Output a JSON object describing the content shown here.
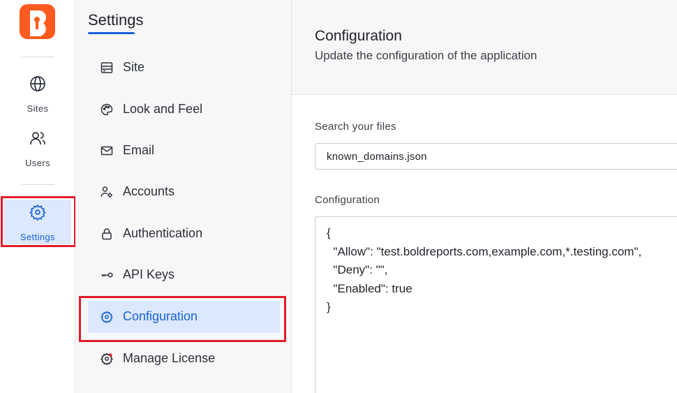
{
  "rail": {
    "logo_letter": "B",
    "items": [
      {
        "label": "Sites",
        "icon": "globe-icon"
      },
      {
        "label": "Users",
        "icon": "users-icon"
      },
      {
        "label": "Settings",
        "icon": "gear-icon",
        "active": true
      }
    ]
  },
  "menu": {
    "title": "Settings",
    "items": [
      {
        "label": "Site",
        "icon": "site-icon"
      },
      {
        "label": "Look and Feel",
        "icon": "palette-icon"
      },
      {
        "label": "Email",
        "icon": "mail-icon"
      },
      {
        "label": "Accounts",
        "icon": "account-settings-icon"
      },
      {
        "label": "Authentication",
        "icon": "lock-icon"
      },
      {
        "label": "API Keys",
        "icon": "key-icon"
      },
      {
        "label": "Configuration",
        "icon": "gear-icon",
        "active": true
      },
      {
        "label": "Manage License",
        "icon": "license-gear-icon"
      }
    ]
  },
  "main": {
    "title": "Configuration",
    "subtitle": "Update the configuration of the application",
    "search_label": "Search your files",
    "search_value": "known_domains.json",
    "config_label": "Configuration",
    "config_text": "{\n  \"Allow\": \"test.boldreports.com,example.com,*.testing.com\",\n  \"Deny\": \"\",\n  \"Enabled\": true\n}"
  },
  "colors": {
    "brand": "#ff5a1f",
    "accent": "#1a62d6",
    "active_bg": "#dbe8fd",
    "highlight_box": "#e21b2a"
  }
}
